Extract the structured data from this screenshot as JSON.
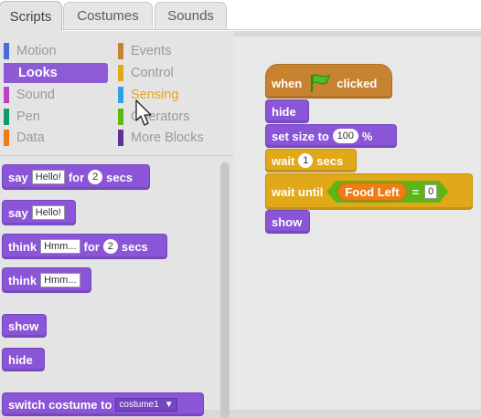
{
  "tabs": [
    {
      "label": "Scripts"
    },
    {
      "label": "Costumes"
    },
    {
      "label": "Sounds"
    }
  ],
  "categories": {
    "motion": {
      "label": "Motion",
      "color": "#4a6cd4"
    },
    "events": {
      "label": "Events",
      "color": "#c88330"
    },
    "looks": {
      "label": "Looks",
      "color": "#8a55d7"
    },
    "control": {
      "label": "Control",
      "color": "#e1a91a"
    },
    "sound": {
      "label": "Sound",
      "color": "#bb42c3"
    },
    "sensing": {
      "label": "Sensing",
      "color": "#2ca5e2"
    },
    "pen": {
      "label": "Pen",
      "color": "#0e9a6c"
    },
    "operators": {
      "label": "Operators",
      "color": "#5cb712"
    },
    "data": {
      "label": "Data",
      "color": "#ee7d16"
    },
    "more": {
      "label": "More Blocks",
      "color": "#632d99"
    }
  },
  "palette": {
    "say_for": {
      "w1": "say",
      "value": "Hello!",
      "w2": "for",
      "secs": "2",
      "w3": "secs"
    },
    "say": {
      "w1": "say",
      "value": "Hello!"
    },
    "think_for": {
      "w1": "think",
      "value": "Hmm...",
      "w2": "for",
      "secs": "2",
      "w3": "secs"
    },
    "think": {
      "w1": "think",
      "value": "Hmm..."
    },
    "show": {
      "label": "show"
    },
    "hide": {
      "label": "hide"
    },
    "switch_costume": {
      "label": "switch costume to",
      "value": "costume1"
    }
  },
  "script": {
    "hat": {
      "w1": "when",
      "w2": "clicked"
    },
    "hide": {
      "label": "hide"
    },
    "set_size": {
      "w1": "set size to",
      "value": "100",
      "w2": "%"
    },
    "wait": {
      "w1": "wait",
      "value": "1",
      "w2": "secs"
    },
    "wait_until": {
      "w1": "wait until",
      "variable": "Food Left",
      "op": "=",
      "value": "0"
    },
    "show": {
      "label": "show"
    }
  }
}
